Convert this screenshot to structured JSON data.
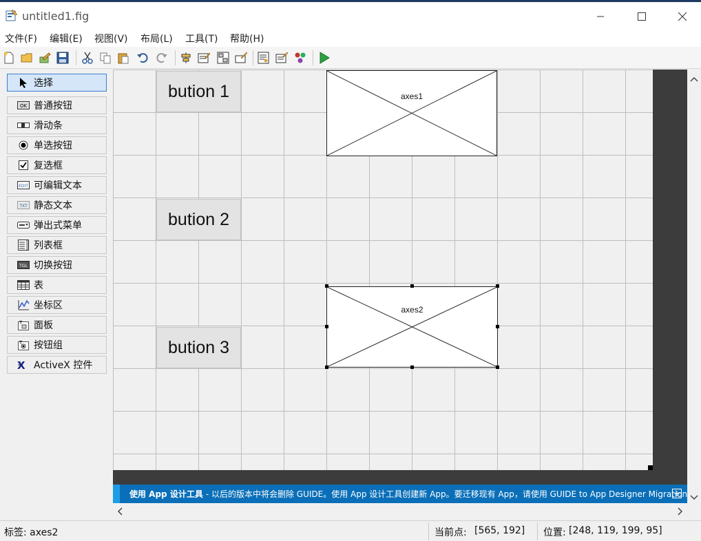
{
  "window": {
    "title": "untitled1.fig",
    "minimize": "—",
    "maximize": "☐",
    "close": "✕"
  },
  "menu": [
    "文件(F)",
    "编辑(E)",
    "视图(V)",
    "布局(L)",
    "工具(T)",
    "帮助(H)"
  ],
  "palette": {
    "select": "选择",
    "items": [
      "普通按钮",
      "滑动条",
      "单选按钮",
      "复选框",
      "可编辑文本",
      "静态文本",
      "弹出式菜单",
      "列表框",
      "切换按钮",
      "表",
      "坐标区",
      "面板",
      "按钮组",
      "ActiveX 控件"
    ]
  },
  "canvas": {
    "buttons": [
      "bution 1",
      "bution 2",
      "bution 3"
    ],
    "axes": [
      "axes1",
      "axes2"
    ],
    "selected": "axes2"
  },
  "banner": {
    "title": "使用 App 设计工具",
    "text": "- 以后的版本中将会删除 GUIDE。使用 App 设计工具创建新 App。要迁移现有 App，请使用 GUIDE to App Designer Migration..."
  },
  "status": {
    "tag_label": "标签: axes2",
    "point_label": "当前点:",
    "point_value": "[565, 192]",
    "position_label": "位置:",
    "position_value": "[248, 119, 199, 95]"
  },
  "colors": {
    "banner": "#0a6fb8",
    "selection": "#d4e6f8",
    "dark_region": "#3c3c3c"
  }
}
